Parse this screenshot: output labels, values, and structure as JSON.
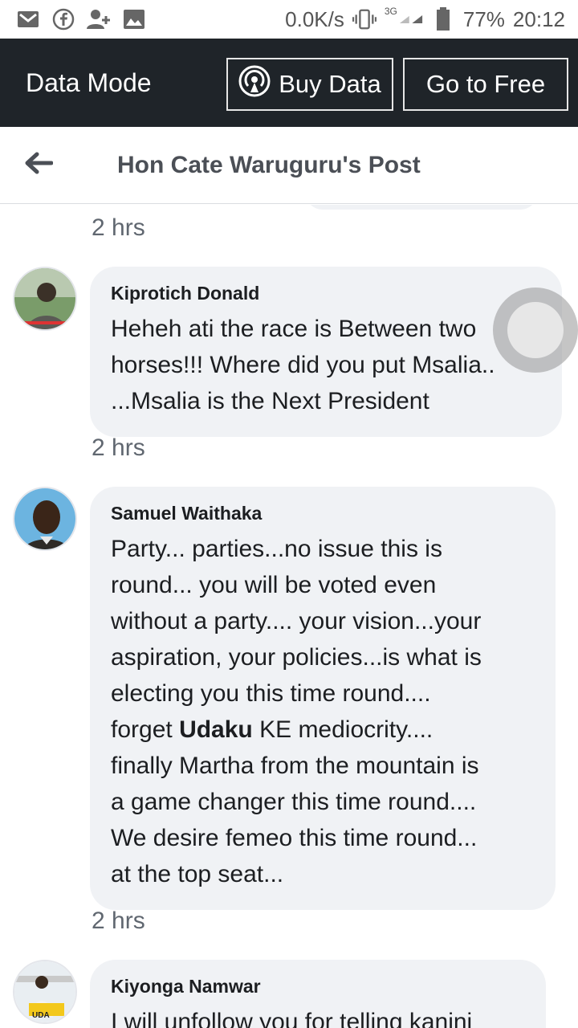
{
  "status_bar": {
    "speed": "0.0K/s",
    "network": "3G",
    "battery": "77%",
    "time": "20:12",
    "icons": [
      "gmail-icon",
      "facebook-icon",
      "add-contact-icon",
      "gallery-icon",
      "vibrate-icon",
      "signal-icon",
      "battery-icon"
    ]
  },
  "data_bar": {
    "title": "Data Mode",
    "buy_label": "Buy Data",
    "free_label": "Go to Free"
  },
  "header": {
    "title": "Hon Cate Waruguru's Post"
  },
  "feed": {
    "prev_time": "2 hrs",
    "comments": [
      {
        "name": "Kiprotich Donald",
        "text": "Heheh ati the race is Between two\nhorses!!! Where did you put Msalia..\n...Msalia is the Next President",
        "time": "2 hrs"
      },
      {
        "name": "Samuel Waithaka",
        "text_a": "Party... parties...no issue this is\nround... you will be voted even\nwithout a party.... your vision...your\naspiration, your policies...is what is\nelecting you this time round....\nforget ",
        "text_bold": "Udaku",
        "text_b": " KE mediocrity....\nfinally Martha from the mountain is\na game changer this time round....\nWe desire femeo this time round...\nat the top seat...",
        "time": "2 hrs"
      },
      {
        "name": "Kiyonga Namwar",
        "text": "I will unfollow you for telling kanini",
        "avatar_badge": "UDA"
      }
    ]
  },
  "colors": {
    "data_bar_bg": "#1f2429",
    "bubble_bg": "#f0f2f5",
    "header_text": "#4b4f56"
  }
}
